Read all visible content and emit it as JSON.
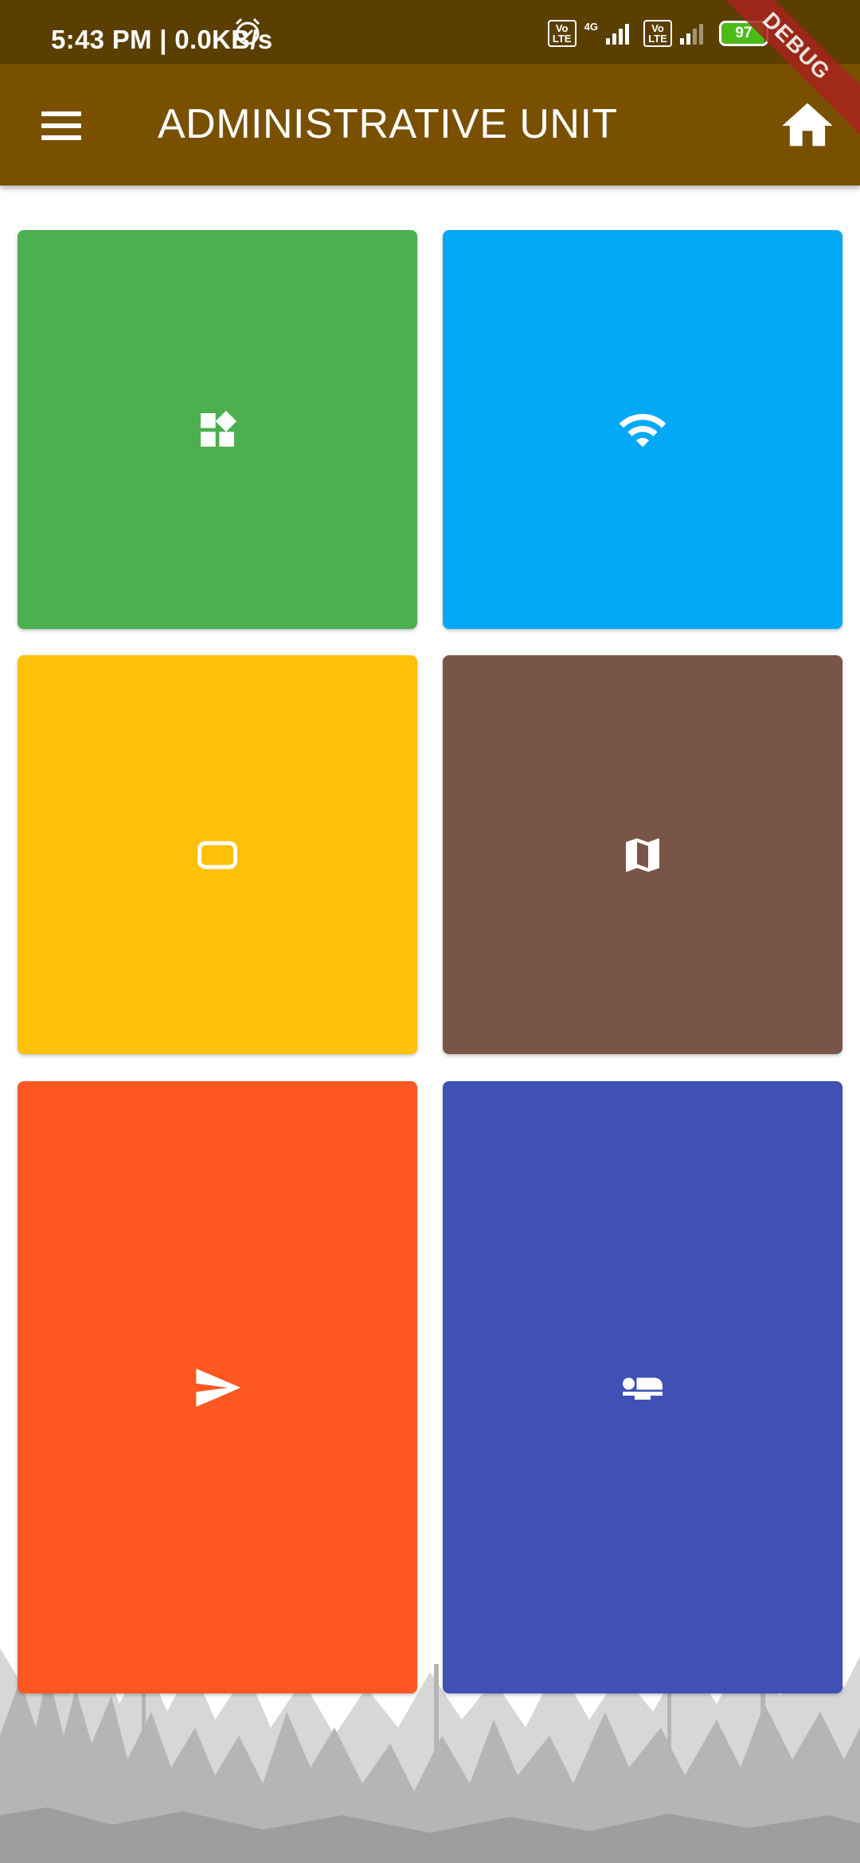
{
  "status_bar": {
    "time": "5:43 PM | 0.0KB/s",
    "volte_label": "Vo LTE",
    "network_label": "4G",
    "battery": "97"
  },
  "debug_banner": "DEBUG",
  "app_bar": {
    "title": "ADMINISTRATIVE UNIT",
    "menu_icon": "menu-icon",
    "home_icon": "home-icon"
  },
  "tiles": [
    {
      "icon": "widgets-icon",
      "color": "#4caf50"
    },
    {
      "icon": "wifi-icon",
      "color": "#03a9f4"
    },
    {
      "icon": "crop-landscape-icon",
      "color": "#ffc107"
    },
    {
      "icon": "map-icon",
      "color": "#795548"
    },
    {
      "icon": "send-icon",
      "color": "#ff5722"
    },
    {
      "icon": "airline-seat-flat-icon",
      "color": "#3f51b5"
    }
  ],
  "colors": {
    "status_bar": "#5a3f00",
    "app_bar": "#785000",
    "background": "#ffffff",
    "forest": "#bdbdbd"
  }
}
